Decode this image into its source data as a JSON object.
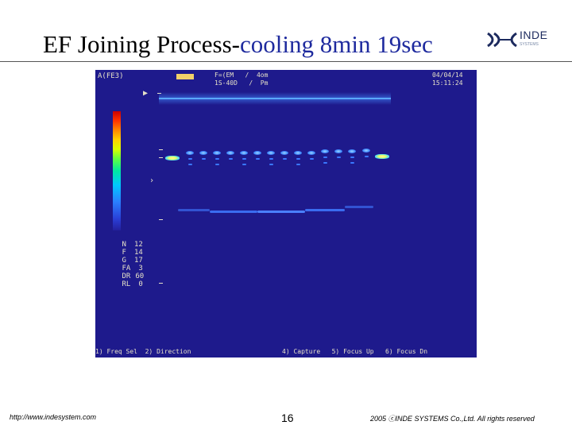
{
  "slide": {
    "title_main": "EF Joining Process-",
    "title_accent": "cooling 8min 19sec",
    "logo_text": "INDE",
    "logo_sub": "SYSTEMS",
    "footer_url": "http://www.indesystem.com",
    "page_number": "16",
    "copyright": "2005 ⓒINDE SYSTEMS Co.,Ltd. All rights reserved"
  },
  "screen": {
    "mode_label": "A(FE3)",
    "freq_line": "F=(EM   /  4om",
    "angle_line": "1S-40D   /  Pm",
    "date": "04/04/14",
    "time": "15:11:24",
    "parameters": [
      {
        "key": "N",
        "value": "12"
      },
      {
        "key": "F",
        "value": "14"
      },
      {
        "key": "G",
        "value": "17"
      },
      {
        "key": "FA",
        "value": "3"
      },
      {
        "key": "DR",
        "value": "60"
      },
      {
        "key": "RL",
        "value": "0"
      }
    ],
    "softkeys_left": "1) Freq Sel  2) Direction",
    "softkeys_right": "4) Capture   5) Focus Up   6) Focus Dn",
    "colors": {
      "background": "#1e1a8c",
      "text": "#e6e1c8",
      "badge": "#f2d06a"
    }
  }
}
